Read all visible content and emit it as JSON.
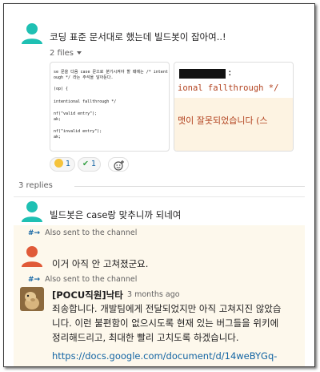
{
  "thread": {
    "message1": {
      "text": "코딩 표준 문서대로 했는데 빌드봇이 잡아여..!",
      "files_label": "2 files",
      "file1_code": [
        "se 문을 다음 case 문으로 분기시켜야 할 때에는 /* intent",
        "ough */ 라는 주석을 달아둔다.",
        "",
        "(op) {",
        "",
        "intentional fallthrough */",
        "",
        "nf(\"valid entry\");",
        "ak;",
        "",
        "nf(\"invalid entry\");",
        "ak;"
      ],
      "file2_colon": ":",
      "file2_line1": "ional fallthrough */",
      "file2_line2": "맷이 잘못되었습니다 (스",
      "reactions": [
        {
          "emoji": "scream-emoji",
          "count": "1"
        },
        {
          "emoji": "check-mark-emoji",
          "count": "1"
        }
      ]
    },
    "replies_label": "3 replies",
    "reply1": {
      "text": "빌드봇은 case랑 맞추니까 되네여"
    },
    "also_sent": "Also sent to the channel",
    "reply2": {
      "text": "이거 아직 안 고쳐졌군요."
    },
    "reply3": {
      "name": "[POCU직원]낙타",
      "time": "3 months ago",
      "lines": [
        "죄송합니다. 개발팀에게 전달되었지만 아직 고쳐지진 않았습",
        "니다. 이런 불편함이 없으시도록 현재 있는 버그들을 위키에",
        "정리해드리고, 최대한 빨리 고치도록 하겠습니다."
      ],
      "link": "https://docs.google.com/document/d/14weBYGq-"
    }
  },
  "colors": {
    "avatar_teal": "#1fc0b3",
    "avatar_orange": "#e05a38",
    "link_blue": "#1264a3",
    "highlight_bg": "#fdf8ec"
  }
}
